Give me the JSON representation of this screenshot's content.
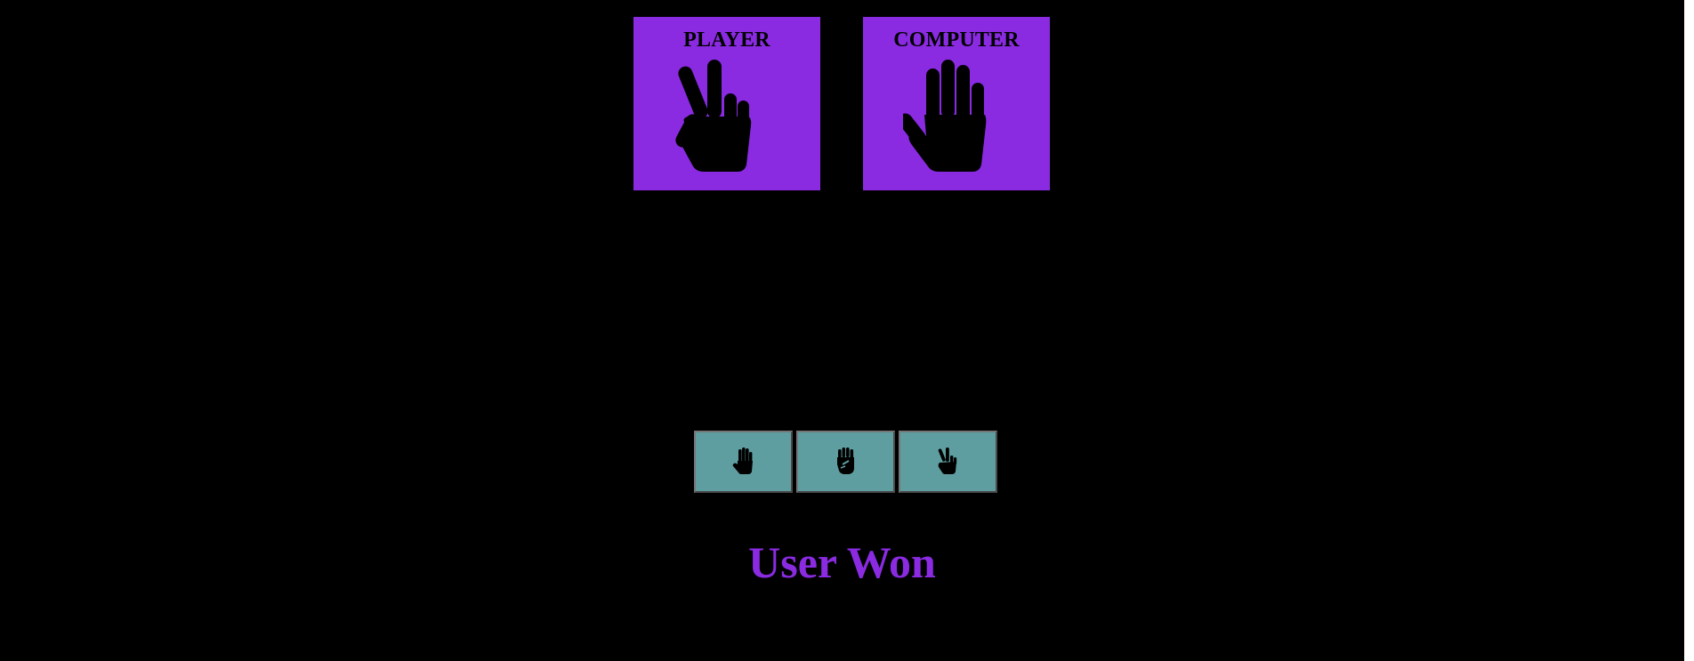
{
  "player": {
    "title": "PLAYER",
    "choice_icon": "scissors-hand-icon"
  },
  "computer": {
    "title": "COMPUTER",
    "choice_icon": "paper-hand-icon"
  },
  "choices": [
    {
      "icon": "paper-hand-icon"
    },
    {
      "icon": "rock-fist-icon"
    },
    {
      "icon": "scissors-hand-icon"
    }
  ],
  "result": {
    "text": "User Won"
  },
  "colors": {
    "background": "#000000",
    "card": "#8a2be2",
    "button": "#5f9ea0",
    "result_text": "#8a2be2"
  }
}
